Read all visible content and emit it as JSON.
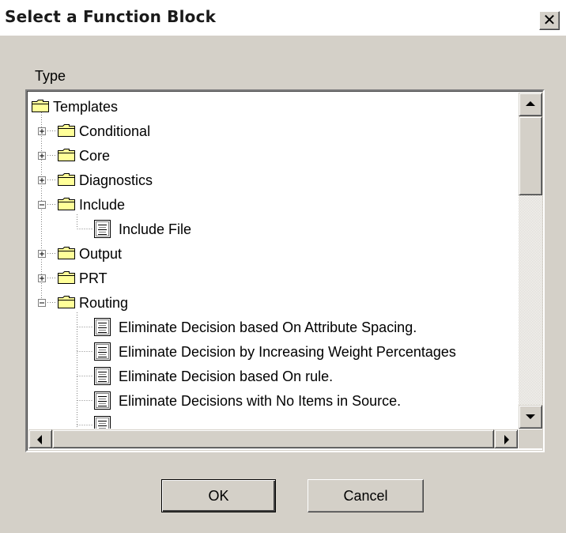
{
  "window": {
    "title": "Select a Function Block",
    "close_glyph": "✕"
  },
  "type_label": "Type",
  "tree": {
    "root": {
      "label": "Templates",
      "icon": "folder-icon"
    },
    "nodes": [
      {
        "label": "Conditional",
        "type": "folder",
        "expander": "plus"
      },
      {
        "label": "Core",
        "type": "folder",
        "expander": "plus"
      },
      {
        "label": "Diagnostics",
        "type": "folder",
        "expander": "plus"
      },
      {
        "label": "Include",
        "type": "folder",
        "expander": "minus"
      },
      {
        "label": "Include File",
        "type": "document",
        "depth": 2
      },
      {
        "label": "Output",
        "type": "folder",
        "expander": "plus"
      },
      {
        "label": "PRT",
        "type": "folder",
        "expander": "plus"
      },
      {
        "label": "Routing",
        "type": "folder",
        "expander": "minus"
      },
      {
        "label": "Eliminate Decision based On Attribute Spacing.",
        "type": "document",
        "depth": 2
      },
      {
        "label": "Eliminate Decision by Increasing Weight Percentages",
        "type": "document",
        "depth": 2
      },
      {
        "label": "Eliminate Decision based On rule.",
        "type": "document",
        "depth": 2
      },
      {
        "label": "Eliminate Decisions with No Items in Source.",
        "type": "document",
        "depth": 2
      }
    ]
  },
  "buttons": {
    "ok": "OK",
    "cancel": "Cancel"
  },
  "colors": {
    "dialog_bg": "#d4d0c8",
    "folder_fill": "#ffff99",
    "tree_bg": "#ffffff"
  }
}
